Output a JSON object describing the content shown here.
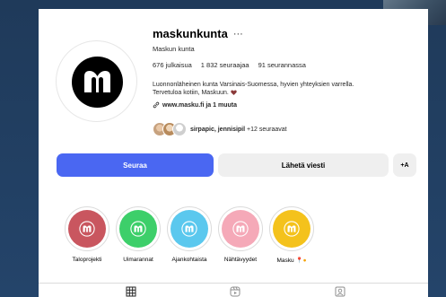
{
  "profile": {
    "username": "maskunkunta",
    "fullname": "Maskun kunta",
    "stats": {
      "posts": "676 julkaisua",
      "followers": "1 832 seuraajaa",
      "following": "91 seurannassa"
    },
    "bio_line1": "Luonnonläheinen kunta Varsinais-Suomessa, hyvien yhteyksien varrella.",
    "bio_line2": "Tervetuloa kotiin, Maskuun.",
    "link": "www.masku.fi ja 1 muuta",
    "followed_by_names": "sirpapic, jennisipil",
    "followed_by_more": "+12 seuraavat"
  },
  "actions": {
    "follow": "Seuraa",
    "message": "Lähetä viesti",
    "suggest": "+A"
  },
  "highlights": [
    {
      "label": "Taloprojekti",
      "color": "#c9565f"
    },
    {
      "label": "Uimarannat",
      "color": "#3dcf6a"
    },
    {
      "label": "Ajankohtaista",
      "color": "#5bc8ee"
    },
    {
      "label": "Nähtävyydet",
      "color": "#f5a9b8"
    },
    {
      "label": "Masku",
      "color": "#f4c21c"
    }
  ],
  "colors": {
    "accent": "#4a67f2",
    "heart": "#8b3a3a"
  },
  "icons": {
    "more": "more-icon",
    "link": "link-icon",
    "heart": "heart-icon",
    "grid_tab": "grid-icon",
    "reels_tab": "reels-icon",
    "tagged_tab": "tagged-icon"
  }
}
